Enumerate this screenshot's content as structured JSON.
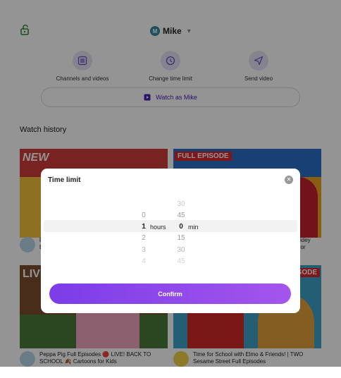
{
  "profile": {
    "initial": "M",
    "name": "Mike"
  },
  "actions": [
    {
      "label": "Channels and videos",
      "icon": "list-icon"
    },
    {
      "label": "Change time limit",
      "icon": "clock-icon"
    },
    {
      "label": "Send video",
      "icon": "send-icon"
    }
  ],
  "watch_button": {
    "label": "Watch as Mike"
  },
  "section": {
    "title": "Watch history"
  },
  "thumbnails": {
    "a_badge": "NEW",
    "b_badge": "FULL EPISODE",
    "c_badge": "LIV",
    "d_badge": "SODE"
  },
  "videos": [
    {
      "title_line1": "P",
      "title_line2": "B"
    },
    {
      "title_line1": "s Spidey",
      "title_line2": "yjunior"
    },
    {
      "title_line1": "Peppa Pig Full Episodes 🔴 LIVE! BACK TO",
      "title_line2": "SCHOOL 🍂 Cartoons for Kids"
    },
    {
      "title_line1": "Time for School with Elmo & Friends! | TWO",
      "title_line2": "Sesame Street Full Episodes"
    }
  ],
  "modal": {
    "title": "Time limit",
    "close_icon": "close-icon",
    "hours_column": [
      "0",
      "1",
      "2",
      "3",
      "4"
    ],
    "minutes_column": [
      "30",
      "45",
      "0",
      "15",
      "30",
      "45"
    ],
    "selected_hours": "1",
    "selected_minutes": "0",
    "hours_unit": "hours",
    "minutes_unit": "min",
    "confirm_label": "Confirm"
  },
  "colors": {
    "accent": "#7b3de8",
    "accent_dark": "#4a22b8",
    "overlay": "rgba(0,0,0,0.42)"
  }
}
